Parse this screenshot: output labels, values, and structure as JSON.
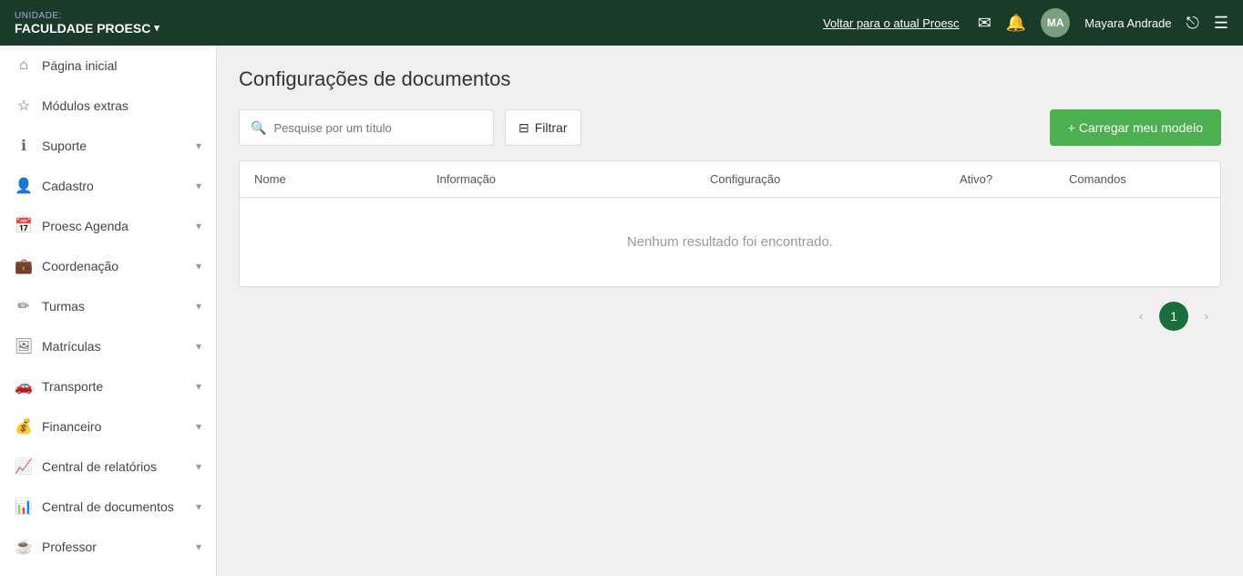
{
  "header": {
    "unit_label": "UNIDADE:",
    "unit_name": "FACULDADE PROESC",
    "back_link": "Voltar para o atual Proesc",
    "user_initials": "MA",
    "user_name": "Mayara Andrade",
    "avatar_color": "#7a9e7e"
  },
  "sidebar": {
    "items": [
      {
        "id": "pagina-inicial",
        "label": "Página inicial",
        "icon": "⌂",
        "has_chevron": false
      },
      {
        "id": "modulos-extras",
        "label": "Módulos extras",
        "icon": "☆",
        "has_chevron": false
      },
      {
        "id": "suporte",
        "label": "Suporte",
        "icon": "ℹ",
        "has_chevron": true
      },
      {
        "id": "cadastro",
        "label": "Cadastro",
        "icon": "👤",
        "has_chevron": true
      },
      {
        "id": "proesc-agenda",
        "label": "Proesc Agenda",
        "icon": "📅",
        "has_chevron": true
      },
      {
        "id": "coordenacao",
        "label": "Coordenação",
        "icon": "💼",
        "has_chevron": true
      },
      {
        "id": "turmas",
        "label": "Turmas",
        "icon": "✏",
        "has_chevron": true
      },
      {
        "id": "matriculas",
        "label": "Matrículas",
        "icon": "🖼",
        "has_chevron": true
      },
      {
        "id": "transporte",
        "label": "Transporte",
        "icon": "🚗",
        "has_chevron": true
      },
      {
        "id": "financeiro",
        "label": "Financeiro",
        "icon": "💰",
        "has_chevron": true
      },
      {
        "id": "central-relatorios",
        "label": "Central de relatórios",
        "icon": "📈",
        "has_chevron": true
      },
      {
        "id": "central-documentos",
        "label": "Central de documentos",
        "icon": "📊",
        "has_chevron": true
      },
      {
        "id": "professor",
        "label": "Professor",
        "icon": "☕",
        "has_chevron": true
      }
    ]
  },
  "content": {
    "page_title": "Configurações de documentos",
    "search_placeholder": "Pesquise por um título",
    "filter_label": "Filtrar",
    "add_button_label": "+ Carregar meu modelo",
    "table": {
      "headers": [
        "Nome",
        "Informação",
        "Configuração",
        "Ativo?",
        "Comandos"
      ],
      "empty_message": "Nenhum resultado foi encontrado."
    },
    "pagination": {
      "prev_label": "‹",
      "next_label": "›",
      "current_page": 1
    }
  }
}
